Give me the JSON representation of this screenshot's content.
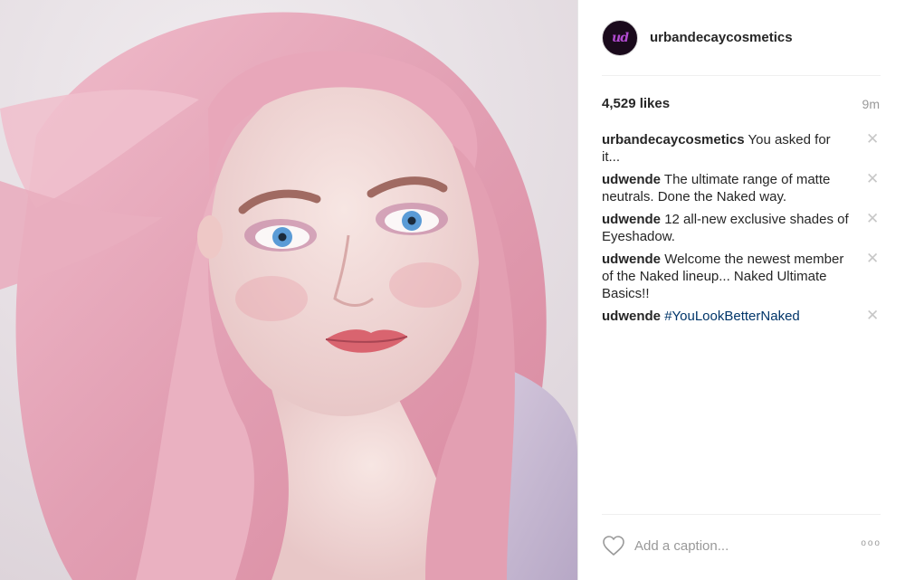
{
  "post": {
    "username": "urbandecaycosmetics",
    "avatar_text": "ud",
    "likes": "4,529 likes",
    "time": "9m"
  },
  "comments": [
    {
      "user": "urbandecaycosmetics",
      "text": "You asked for it..."
    },
    {
      "user": "udwende",
      "text": "The ultimate range of matte neutrals. Done the Naked way."
    },
    {
      "user": "udwende",
      "text": "12 all-new exclusive shades of Eyeshadow."
    },
    {
      "user": "udwende",
      "text": "Welcome the newest member of the Naked lineup... Naked Ultimate Basics!!"
    },
    {
      "user": "udwende",
      "text": "",
      "hashtag": "#YouLookBetterNaked"
    }
  ],
  "footer": {
    "caption_placeholder": "Add a caption...",
    "more_icon": "ooo"
  },
  "colors": {
    "hashtag": "#003569",
    "avatar_bg": "#1a0a1c",
    "avatar_accent": "#b24bd1",
    "hair": "#e8a5b8"
  }
}
